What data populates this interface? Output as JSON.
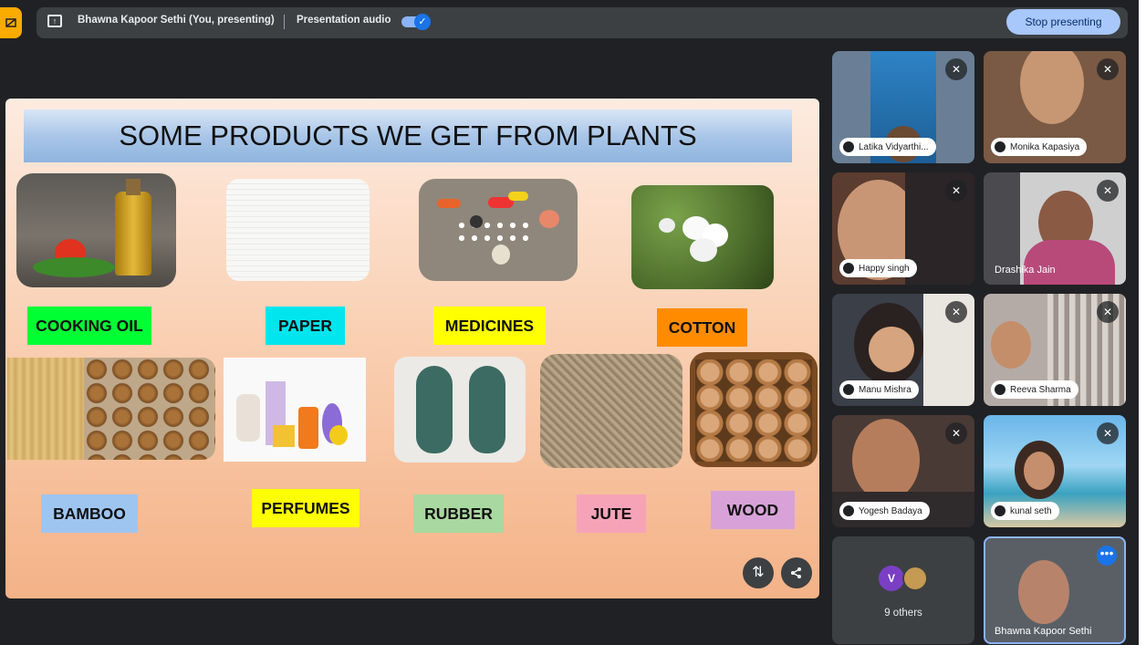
{
  "topbar": {
    "presenter": "Bhawna Kapoor Sethi (You, presenting)",
    "audio_label": "Presentation audio",
    "toggle_check": "✓",
    "stop_label": "Stop presenting"
  },
  "slide": {
    "title": "SOME PRODUCTS WE GET FROM PLANTS",
    "labels": {
      "cooking_oil": "COOKING OIL",
      "paper": "PAPER",
      "medicines": "MEDICINES",
      "cotton": "COTTON",
      "bamboo": "BAMBOO",
      "perfumes": "PERFUMES",
      "rubber": "RUBBER",
      "jute": "JUTE",
      "wood": "WOOD"
    },
    "label_colors": {
      "cooking_oil": "#00ff33",
      "paper": "#00e5ee",
      "medicines": "#ffff00",
      "cotton": "#ff8c00",
      "bamboo": "#9ec5f0",
      "perfumes": "#ffff00",
      "rubber": "#a9d8a0",
      "jute": "#f6a3b8",
      "wood": "#d8a2d8"
    }
  },
  "controls": {
    "swap_icon": "swap-icon",
    "share_icon": "share-icon"
  },
  "participants": [
    {
      "name": "Latika Vidyarthi..."
    },
    {
      "name": "Monika Kapasiya"
    },
    {
      "name": "Happy singh"
    },
    {
      "name": "Drashika Jain"
    },
    {
      "name": "Manu Mishra"
    },
    {
      "name": "Reeva Sharma"
    },
    {
      "name": "Yogesh Badaya"
    },
    {
      "name": "kunal seth"
    }
  ],
  "others": {
    "avatar_letter": "V",
    "label": "9 others"
  },
  "self_tile": {
    "name": "Bhawna Kapoor Sethi",
    "more_icon": "more-icon"
  }
}
